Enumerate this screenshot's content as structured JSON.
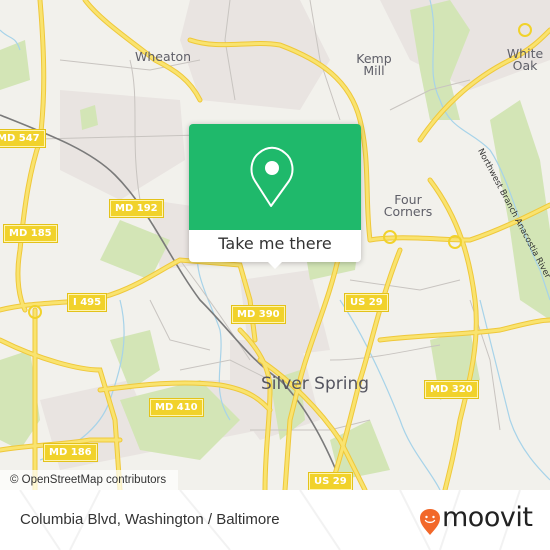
{
  "map": {
    "places": [
      {
        "id": "wheaton",
        "label": "Wheaton"
      },
      {
        "id": "kemp-mill",
        "label": "Kemp Mill"
      },
      {
        "id": "white-oak",
        "label": "White Oak"
      },
      {
        "id": "four-corners",
        "label": "Four Corners"
      },
      {
        "id": "silver-spring",
        "label": "Silver Spring"
      }
    ],
    "road_shields": [
      "MD 547",
      "MD 192",
      "MD 185",
      "I 495",
      "MD 390",
      "US 29",
      "MD 410",
      "MD 186",
      "MD 320",
      "US 29"
    ],
    "river_label": "Northwest Branch Anacostia River",
    "attribution": "© OpenStreetMap contributors",
    "colors": {
      "background": "#f2f1ec",
      "road": "#f7dc5a",
      "park": "#cfe3b0",
      "residential": "#e8e2e0",
      "water": "#a7d3e9"
    }
  },
  "popup": {
    "icon": "map-pin-icon",
    "button_label": "Take me there",
    "color": "#1fb96b"
  },
  "footer": {
    "location": "Columbia Blvd, Washington / Baltimore",
    "brand": "moovit",
    "brand_color": "#f2682a"
  }
}
